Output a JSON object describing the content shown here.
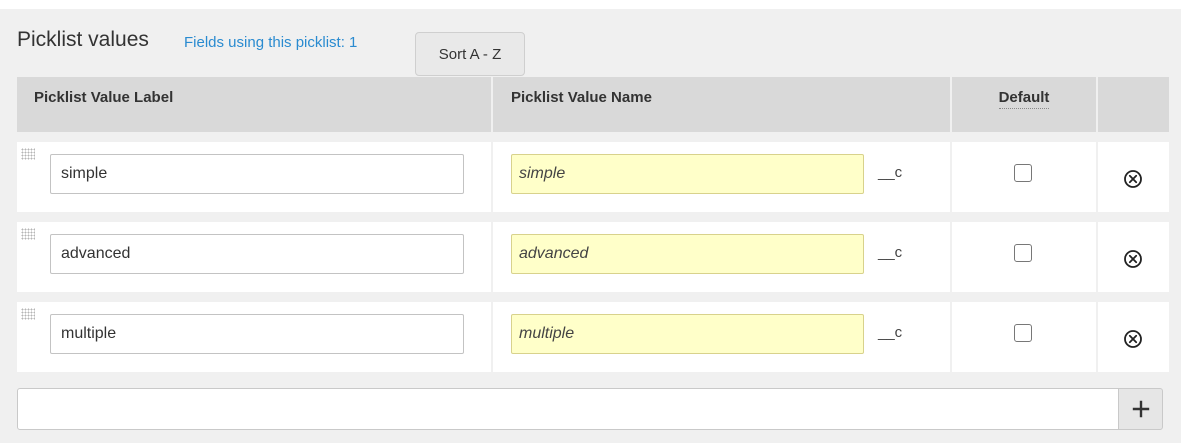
{
  "title": "Picklist values",
  "fields_link": "Fields using this picklist: 1",
  "sort_label": "Sort A - Z",
  "columns": {
    "label": "Picklist Value Label",
    "name": "Picklist Value Name",
    "default": "Default",
    "actions": ""
  },
  "suffix": "__c",
  "rows": [
    {
      "label": "simple",
      "name": "simple",
      "default": false
    },
    {
      "label": "advanced",
      "name": "advanced",
      "default": false
    },
    {
      "label": "multiple",
      "name": "multiple",
      "default": false
    }
  ],
  "new_value": "",
  "icons": {
    "drag": "drag-handle-icon",
    "remove": "remove-circle-icon",
    "add": "plus-icon"
  },
  "colors": {
    "panel_bg": "#f0f0f0",
    "header_bg": "#d9d9d9",
    "name_field_bg": "#ffffc9",
    "link": "#2a8bd0"
  }
}
